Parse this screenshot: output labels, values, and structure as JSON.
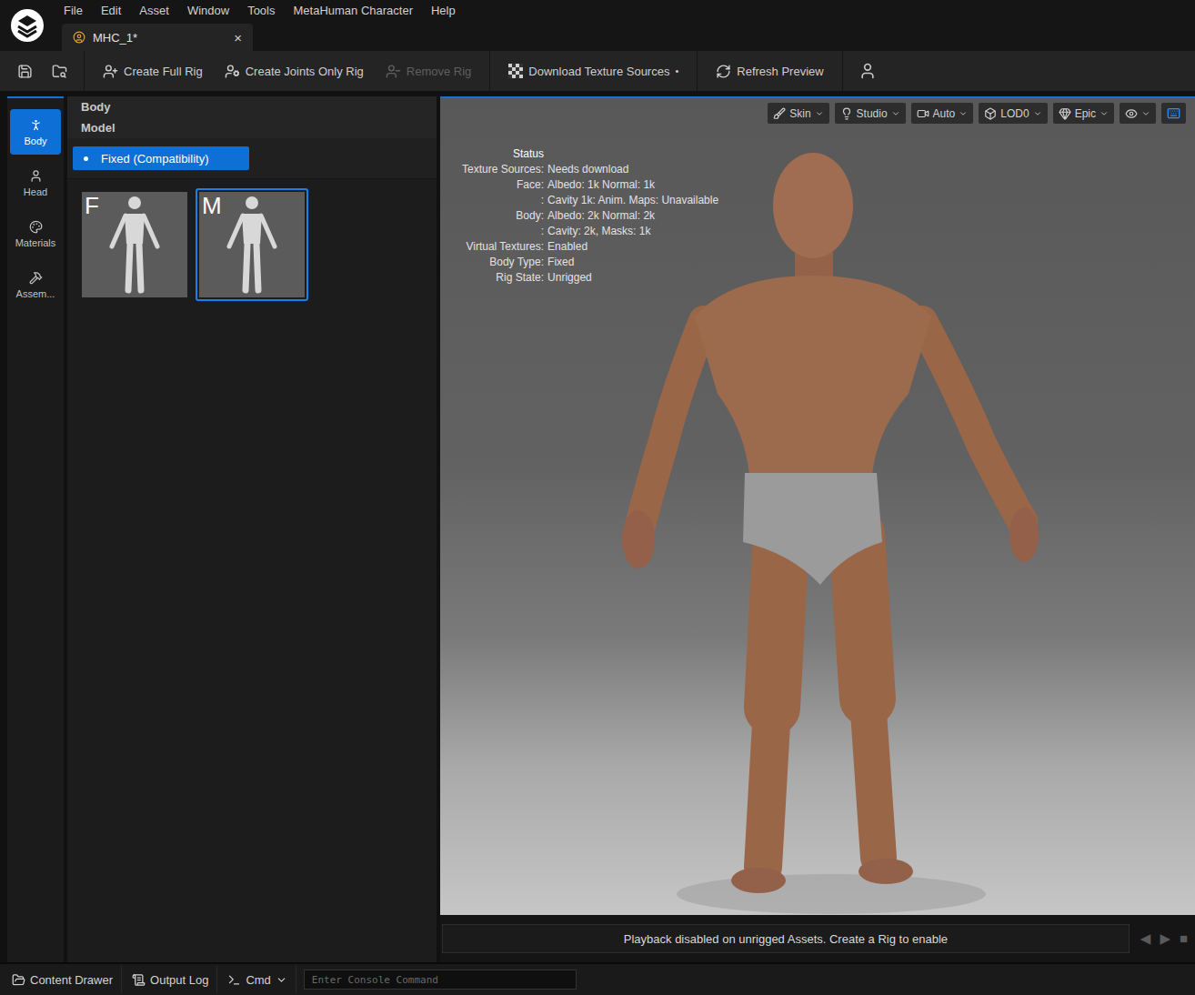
{
  "menu": [
    "File",
    "Edit",
    "Asset",
    "Window",
    "Tools",
    "MetaHuman Character",
    "Help"
  ],
  "tabs": [
    {
      "label": "MHC_1*",
      "selected": true,
      "close": "×"
    }
  ],
  "toolbar": [
    {
      "label": "Create Full Rig",
      "kind": "rig",
      "disabled": false,
      "badge": ""
    },
    {
      "label": "Create Joints Only Rig",
      "kind": "joints",
      "disabled": false,
      "badge": ""
    },
    {
      "label": "Remove Rig",
      "kind": "remove",
      "disabled": true,
      "badge": ""
    },
    {
      "label": "Download Texture Sources",
      "kind": "download",
      "disabled": false,
      "badge": "•"
    },
    {
      "label": "Refresh Preview",
      "kind": "refresh",
      "disabled": false,
      "badge": ""
    }
  ],
  "sidebar": {
    "items": [
      {
        "label": "Body",
        "kind": "body",
        "selected": true
      },
      {
        "label": "Head",
        "kind": "head",
        "selected": false
      },
      {
        "label": "Materials",
        "kind": "materials",
        "selected": false
      },
      {
        "label": "Assem...",
        "kind": "assembly",
        "selected": false
      }
    ]
  },
  "panel": {
    "title": "Body",
    "section": "Model",
    "options": [
      {
        "label": "Fixed (Compatibility)",
        "selected": true
      }
    ],
    "presets": [
      {
        "label": "F",
        "selected": false
      },
      {
        "label": "M",
        "selected": true
      }
    ]
  },
  "viewport": {
    "buttons": [
      {
        "label": "Skin",
        "kind": "skin"
      },
      {
        "label": "Studio",
        "kind": "studio"
      },
      {
        "label": "Auto",
        "kind": "auto"
      },
      {
        "label": "LOD0",
        "kind": "lod"
      },
      {
        "label": "Epic",
        "kind": "epic"
      }
    ],
    "status": {
      "title": "Status",
      "rows": [
        {
          "label": "Texture Sources:",
          "value": "Needs download"
        },
        {
          "label": "Face:",
          "value": "Albedo: 1k Normal: 1k"
        },
        {
          "label": ":",
          "value": "Cavity 1k: Anim. Maps: Unavailable"
        },
        {
          "label": "Body:",
          "value": "Albedo: 2k Normal: 2k"
        },
        {
          "label": ":",
          "value": "Cavity: 2k, Masks: 1k"
        },
        {
          "label": "Virtual Textures:",
          "value": "Enabled"
        },
        {
          "label": "Body Type:",
          "value": "Fixed"
        },
        {
          "label": "Rig State:",
          "value": "Unrigged"
        }
      ]
    },
    "playback": {
      "message": "Playback disabled on unrigged Assets. Create a Rig to enable",
      "controls": [
        "◀",
        "▶",
        "■"
      ]
    }
  },
  "status_bar": {
    "items": [
      {
        "label": "Content Drawer",
        "kind": "drawer"
      },
      {
        "label": "Output Log",
        "kind": "log"
      },
      {
        "label": "Cmd",
        "kind": "cmd"
      }
    ],
    "console": {
      "placeholder": "Enter Console Command"
    }
  }
}
